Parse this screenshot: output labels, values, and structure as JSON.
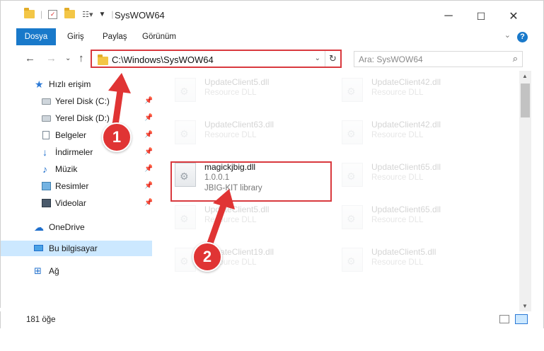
{
  "window": {
    "title": "SysWOW64",
    "controls": {
      "minimize": "─",
      "maximize": "☐",
      "close": "✕"
    }
  },
  "ribbon": {
    "tabs": [
      "Dosya",
      "Giriş",
      "Paylaş",
      "Görünüm"
    ],
    "help": "?"
  },
  "address": {
    "path": "C:\\Windows\\SysWOW64",
    "search_placeholder": "Ara: SysWOW64"
  },
  "nav": {
    "items": [
      {
        "label": "Hızlı erişim",
        "icon": "star-icon"
      },
      {
        "label": "Yerel Disk (C:)",
        "icon": "disk-icon",
        "pinned": true
      },
      {
        "label": "Yerel Disk (D:)",
        "icon": "disk-icon",
        "pinned": true
      },
      {
        "label": "Belgeler",
        "icon": "doc-icon",
        "pinned": true
      },
      {
        "label": "İndirmeler",
        "icon": "download-icon",
        "pinned": true
      },
      {
        "label": "Müzik",
        "icon": "music-icon",
        "pinned": true
      },
      {
        "label": "Resimler",
        "icon": "picture-icon",
        "pinned": true
      },
      {
        "label": "Videolar",
        "icon": "video-icon",
        "pinned": true
      },
      {
        "label": "OneDrive",
        "icon": "cloud-icon"
      },
      {
        "label": "Bu bilgisayar",
        "icon": "computer-icon",
        "selected": true
      },
      {
        "label": "Ağ",
        "icon": "network-icon"
      }
    ]
  },
  "files": [
    {
      "name": "UpdateClient5.dll",
      "desc": "Resource DLL",
      "faded": true
    },
    {
      "name": "UpdateClient42.dll",
      "desc": "Resource DLL",
      "faded": true
    },
    {
      "name": "UpdateClient63.dll",
      "desc": "Resource DLL",
      "faded": true
    },
    {
      "name": "UpdateClient42.dll",
      "desc": "Resource DLL",
      "faded": true
    },
    {
      "name": "magickjbig.dll",
      "version": "1.0.0.1",
      "desc": "JBIG-KIT library",
      "highlighted": true
    },
    {
      "name": "UpdateClient65.dll",
      "desc": "Resource DLL",
      "faded": true
    },
    {
      "name": "UpdateClient5.dll",
      "desc": "Resource DLL",
      "faded": true
    },
    {
      "name": "UpdateClient65.dll",
      "desc": "Resource DLL",
      "faded": true
    },
    {
      "name": "UpdateClient19.dll",
      "desc": "Resource DLL",
      "faded": true
    },
    {
      "name": "UpdateClient5.dll",
      "desc": "Resource DLL",
      "faded": true
    }
  ],
  "status": {
    "count": "181 öğe"
  },
  "steps": [
    "1",
    "2"
  ],
  "colors": {
    "accent": "#1979ca",
    "marker": "#d9393e"
  }
}
